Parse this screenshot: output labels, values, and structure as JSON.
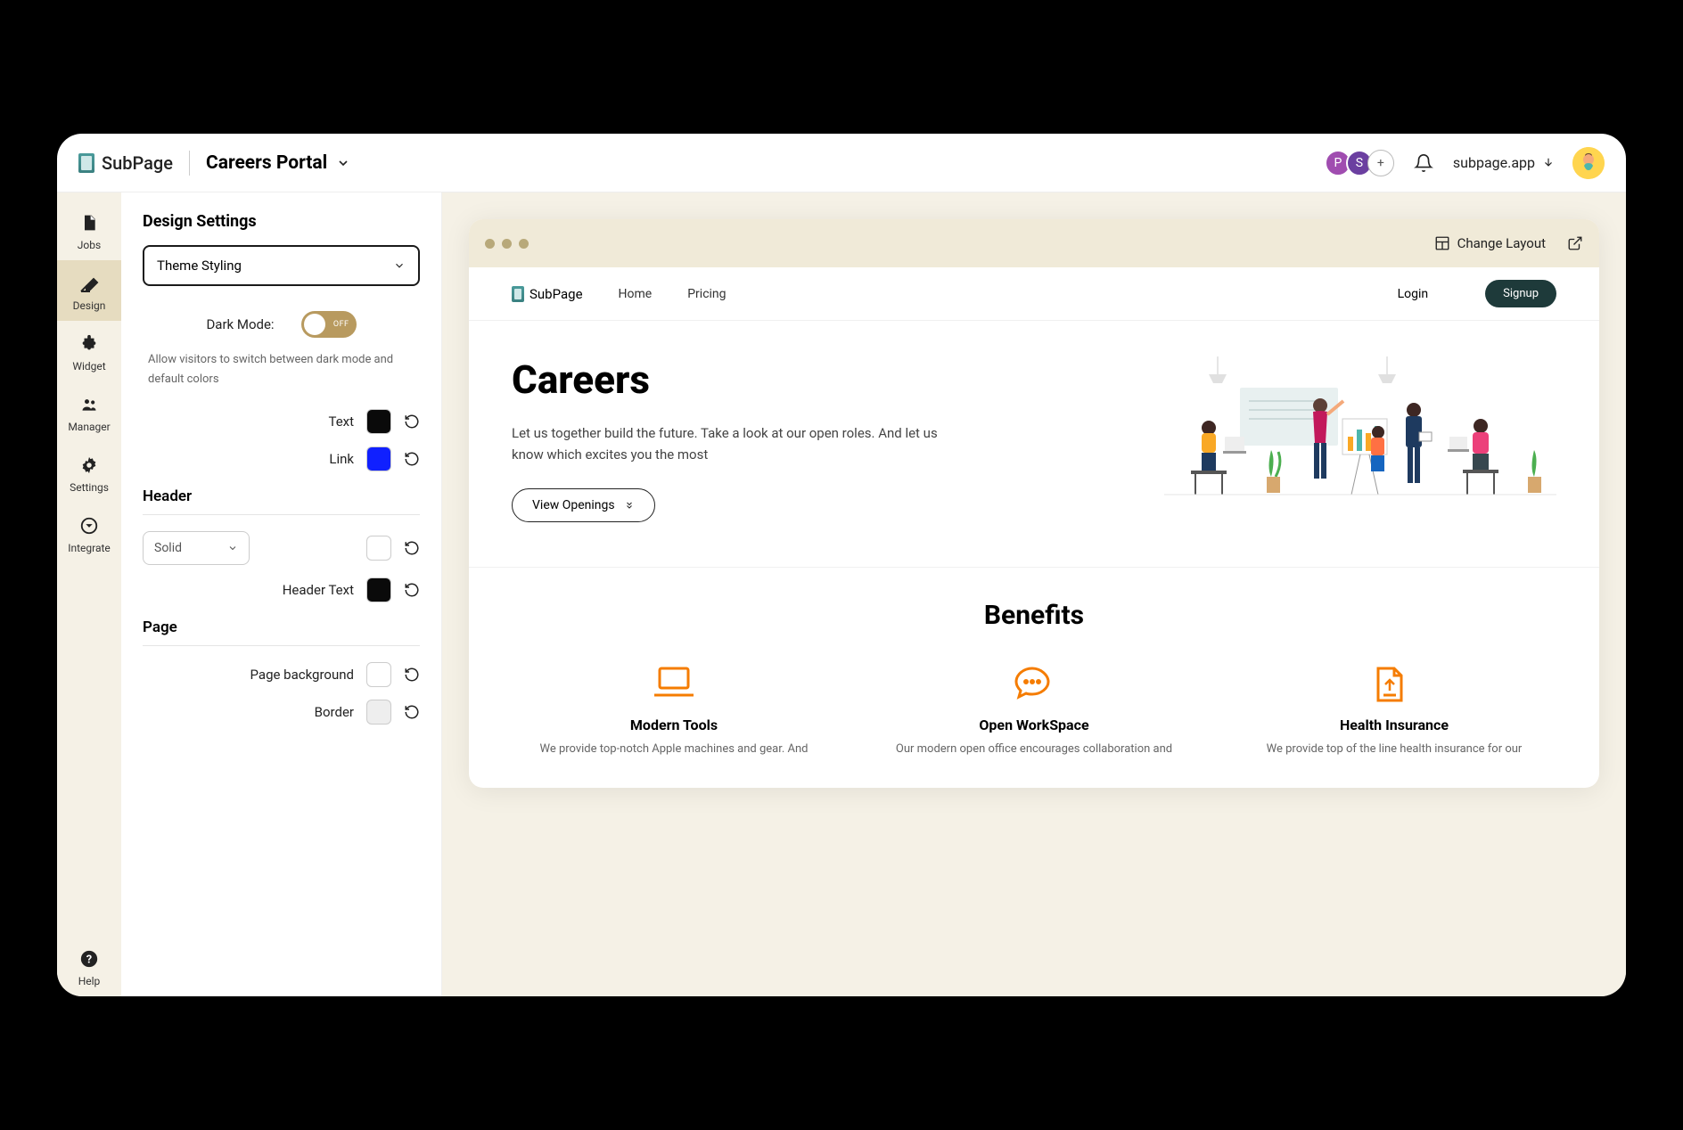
{
  "header": {
    "brand": "SubPage",
    "portal": "Careers Portal",
    "domain": "subpage.app",
    "avatars": [
      "P",
      "S",
      "+"
    ]
  },
  "sidebar": {
    "items": [
      {
        "label": "Jobs"
      },
      {
        "label": "Design"
      },
      {
        "label": "Widget"
      },
      {
        "label": "Manager"
      },
      {
        "label": "Settings"
      },
      {
        "label": "Integrate"
      },
      {
        "label": "Help"
      }
    ]
  },
  "settings": {
    "title": "Design Settings",
    "theme_select": "Theme Styling",
    "dark_mode_label": "Dark Mode:",
    "dark_mode_state": "OFF",
    "dark_mode_hint": "Allow visitors to switch between dark mode and default colors",
    "text_label": "Text",
    "link_label": "Link",
    "header_section": "Header",
    "header_style": "Solid",
    "header_text_label": "Header Text",
    "page_section": "Page",
    "page_bg_label": "Page background",
    "border_label": "Border",
    "colors": {
      "text": "#0a0a0a",
      "link": "#1020ff",
      "header_bg": "#ffffff",
      "header_text": "#0a0a0a",
      "page_bg": "#ffffff",
      "border": "#e5e5e5"
    }
  },
  "preview": {
    "change_layout": "Change Layout",
    "site": {
      "brand": "SubPage",
      "nav": [
        "Home",
        "Pricing"
      ],
      "login": "Login",
      "signup": "Signup"
    },
    "hero": {
      "title": "Careers",
      "subtitle": "Let us together build the future. Take a look at our open roles. And let us know which excites you the most",
      "cta": "View Openings"
    },
    "benefits": {
      "title": "Benefits",
      "items": [
        {
          "title": "Modern Tools",
          "desc": "We provide top-notch Apple machines and gear. And"
        },
        {
          "title": "Open WorkSpace",
          "desc": "Our modern open office encourages collaboration and"
        },
        {
          "title": "Health Insurance",
          "desc": "We provide top of the line health insurance for our"
        }
      ]
    }
  }
}
